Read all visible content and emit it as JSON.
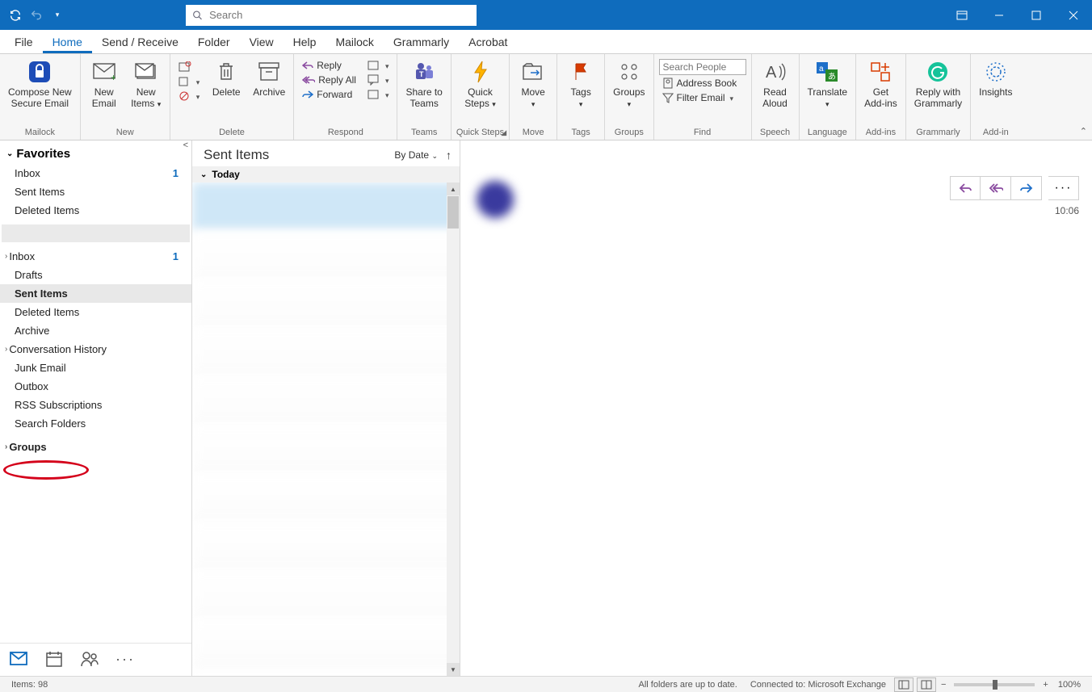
{
  "titlebar": {
    "search_placeholder": "Search"
  },
  "tabs": [
    "File",
    "Home",
    "Send / Receive",
    "Folder",
    "View",
    "Help",
    "Mailock",
    "Grammarly",
    "Acrobat"
  ],
  "ribbon": {
    "mailock": {
      "compose": "Compose New\nSecure Email",
      "group": "Mailock"
    },
    "new": {
      "email": "New\nEmail",
      "items": "New\nItems",
      "group": "New"
    },
    "delete": {
      "delete": "Delete",
      "archive": "Archive",
      "group": "Delete"
    },
    "respond": {
      "reply": "Reply",
      "reply_all": "Reply All",
      "forward": "Forward",
      "group": "Respond"
    },
    "teams": {
      "share": "Share to\nTeams",
      "group": "Teams"
    },
    "quicksteps": {
      "quick": "Quick\nSteps",
      "group": "Quick Steps"
    },
    "move": {
      "move": "Move",
      "group": "Move"
    },
    "tags": {
      "tags": "Tags",
      "group": "Tags"
    },
    "groups": {
      "groups": "Groups",
      "group": "Groups"
    },
    "find": {
      "search_placeholder": "Search People",
      "address_book": "Address Book",
      "filter": "Filter Email",
      "group": "Find"
    },
    "speech": {
      "read": "Read\nAloud",
      "group": "Speech"
    },
    "language": {
      "translate": "Translate",
      "group": "Language"
    },
    "addins": {
      "get": "Get\nAdd-ins",
      "group": "Add-ins"
    },
    "grammarly": {
      "reply": "Reply with\nGrammarly",
      "group": "Grammarly"
    },
    "addin2": {
      "insights": "Insights",
      "group": "Add-in"
    }
  },
  "nav": {
    "favorites": "Favorites",
    "fav_items": [
      {
        "label": "Inbox",
        "count": "1"
      },
      {
        "label": "Sent Items"
      },
      {
        "label": "Deleted Items"
      }
    ],
    "account_items": [
      {
        "label": "Inbox",
        "count": "1",
        "chev": true
      },
      {
        "label": "Drafts"
      },
      {
        "label": "Sent Items",
        "selected": true
      },
      {
        "label": "Deleted Items"
      },
      {
        "label": "Archive"
      },
      {
        "label": "Conversation History",
        "chev": true
      },
      {
        "label": "Junk Email"
      },
      {
        "label": "Outbox"
      },
      {
        "label": "RSS Subscriptions"
      },
      {
        "label": "Search Folders"
      }
    ],
    "groups": "Groups"
  },
  "list": {
    "title": "Sent Items",
    "sort": "By Date",
    "group": "Today"
  },
  "reading": {
    "time": "10:06"
  },
  "status": {
    "items": "Items: 98",
    "uptodate": "All folders are up to date.",
    "connected": "Connected to: Microsoft Exchange",
    "zoom": "100%"
  }
}
